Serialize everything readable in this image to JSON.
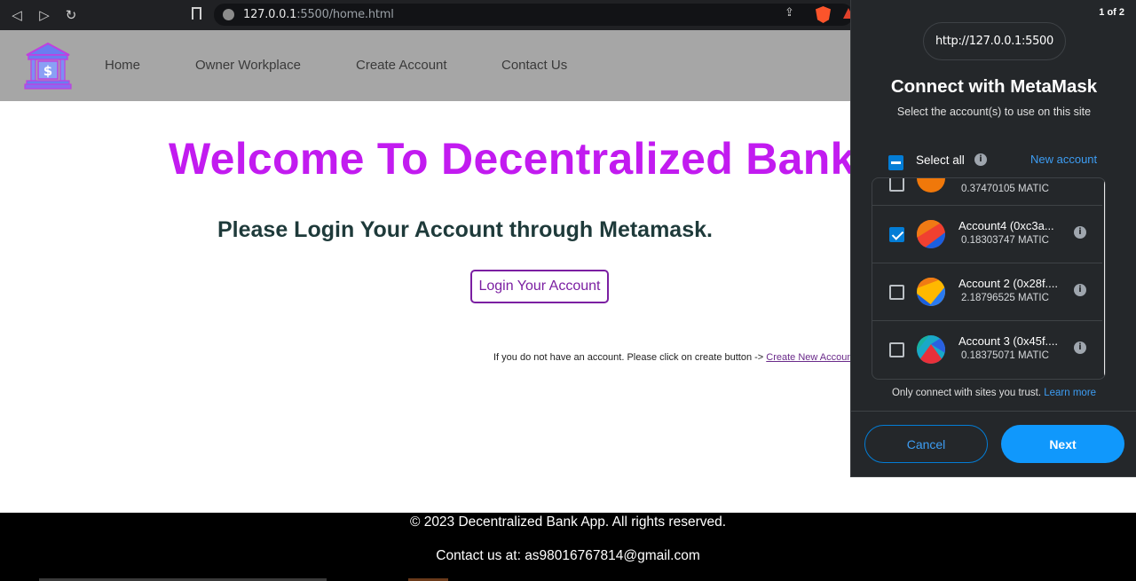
{
  "browser": {
    "url_host": "127.0.0.1",
    "url_rest": ":5500/home.html"
  },
  "site": {
    "nav": [
      "Home",
      "Owner Workplace",
      "Create Account",
      "Contact Us"
    ],
    "welcome": "Welcome To Decentralized Bank",
    "subtitle": "Please Login Your Account through Metamask.",
    "login_button": "Login Your Account",
    "note_text": "If you do not have an account. Please click on create button -> ",
    "note_link": "Create New Account",
    "footer_copyright": "© 2023 Decentralized Bank App. All rights reserved.",
    "footer_contact": "Contact us at: as98016767814@gmail.com"
  },
  "metamask": {
    "page_indicator": "1 of 2",
    "origin": "http://127.0.0.1:5500",
    "title": "Connect with MetaMask",
    "subtitle": "Select the account(s) to use on this site",
    "select_all": "Select all",
    "new_account": "New account",
    "accounts": [
      {
        "name": "",
        "balance": "0.37470105 MATIC",
        "checked": false
      },
      {
        "name": "Account4 (0xc3a...",
        "balance": "0.18303747 MATIC",
        "checked": true
      },
      {
        "name": "Account 2 (0x28f....",
        "balance": "2.18796525 MATIC",
        "checked": false
      },
      {
        "name": "Account 3 (0x45f....",
        "balance": "0.18375071 MATIC",
        "checked": false
      }
    ],
    "trust_text": "Only connect with sites you trust.",
    "learn_more": "Learn more",
    "cancel": "Cancel",
    "next": "Next",
    "colors": {
      "accent": "#1098fc",
      "background": "#24272a"
    }
  }
}
